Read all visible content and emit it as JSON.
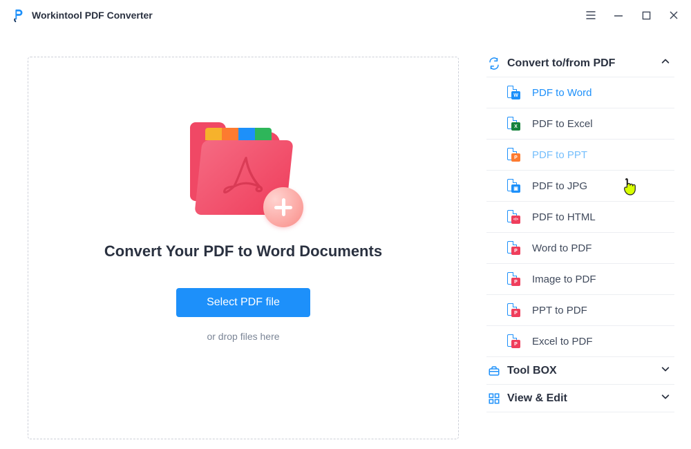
{
  "header": {
    "title": "Workintool PDF Converter"
  },
  "main": {
    "heading": "Convert Your PDF to Word Documents",
    "select_button": "Select PDF file",
    "drop_hint": "or drop files here"
  },
  "sidebar": {
    "groups": [
      {
        "title": "Convert to/from PDF",
        "expanded": true,
        "items": [
          {
            "label": "PDF to Word",
            "icon": "word",
            "state": "active"
          },
          {
            "label": "PDF to Excel",
            "icon": "excel",
            "state": "normal"
          },
          {
            "label": "PDF to PPT",
            "icon": "ppt",
            "state": "hovered"
          },
          {
            "label": "PDF to JPG",
            "icon": "jpg",
            "state": "normal"
          },
          {
            "label": "PDF to HTML",
            "icon": "html",
            "state": "normal"
          },
          {
            "label": "Word to PDF",
            "icon": "pdf",
            "state": "normal"
          },
          {
            "label": "Image to PDF",
            "icon": "pdf",
            "state": "normal"
          },
          {
            "label": "PPT to PDF",
            "icon": "pdf",
            "state": "normal"
          },
          {
            "label": "Excel to PDF",
            "icon": "pdf",
            "state": "normal"
          }
        ]
      },
      {
        "title": "Tool BOX",
        "expanded": false
      },
      {
        "title": "View & Edit",
        "expanded": false
      }
    ]
  },
  "icons": {
    "word": "W",
    "excel": "X",
    "ppt": "P",
    "jpg": "▣",
    "html": "</>",
    "pdf": "P"
  },
  "colors": {
    "accent": "#1d90fa",
    "hovered": "#74befc"
  }
}
